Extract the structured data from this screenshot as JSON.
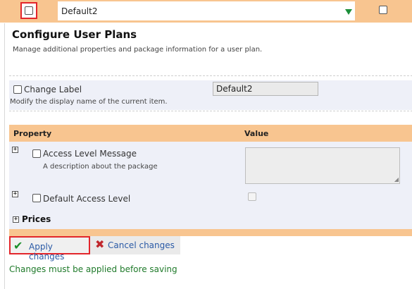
{
  "top": {
    "row_checked": false,
    "plan_select_value": "Default2",
    "right_checked": false
  },
  "panel": {
    "title": "Configure User Plans",
    "subtitle": "Manage additional properties and package information for a user plan."
  },
  "change_label": {
    "label": "Change Label",
    "hint": "Modify the display name of the current item.",
    "value": "Default2"
  },
  "properties": {
    "header_property": "Property",
    "header_value": "Value",
    "rows": [
      {
        "name": "Access Level Message",
        "description": "A description about the package",
        "expander": "+"
      },
      {
        "name": "Default Access Level",
        "description": "",
        "expander": "+"
      }
    ],
    "prices_label": "Prices",
    "prices_expander": "+"
  },
  "actions": {
    "apply_label": "Apply changes",
    "cancel_label": "Cancel changes"
  },
  "status_message": "Changes must be applied before saving",
  "colors": {
    "accent_orange": "#f8c590",
    "row_bg": "#eef0f8",
    "highlight_red": "#e3262b",
    "link_blue": "#2a5aa6",
    "status_green": "#1f7a2a"
  },
  "icons": {
    "apply": "checkmark-icon",
    "cancel": "x-icon",
    "dropdown": "triangle-down-icon",
    "expand": "plus-box-icon"
  }
}
